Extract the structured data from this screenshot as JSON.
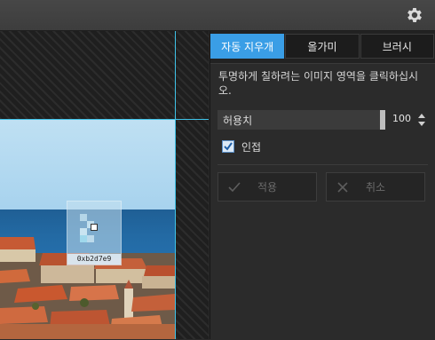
{
  "canvas": {
    "magnifier_hex": "0xb2d7e9"
  },
  "panel": {
    "tabs": [
      {
        "label": "자동 지우개",
        "active": true
      },
      {
        "label": "올가미",
        "active": false
      },
      {
        "label": "브러시",
        "active": false
      }
    ],
    "description": "투명하게 칠하려는 이미지 영역을 클릭하십시오.",
    "tolerance": {
      "label": "허용치",
      "value": "100"
    },
    "contiguous": {
      "label": "인접",
      "checked": true
    },
    "apply_label": "적용",
    "cancel_label": "취소"
  },
  "colors": {
    "accent": "#3a9ee6",
    "guide": "#3fc3e8",
    "panel_bg": "#2b2b2b"
  }
}
